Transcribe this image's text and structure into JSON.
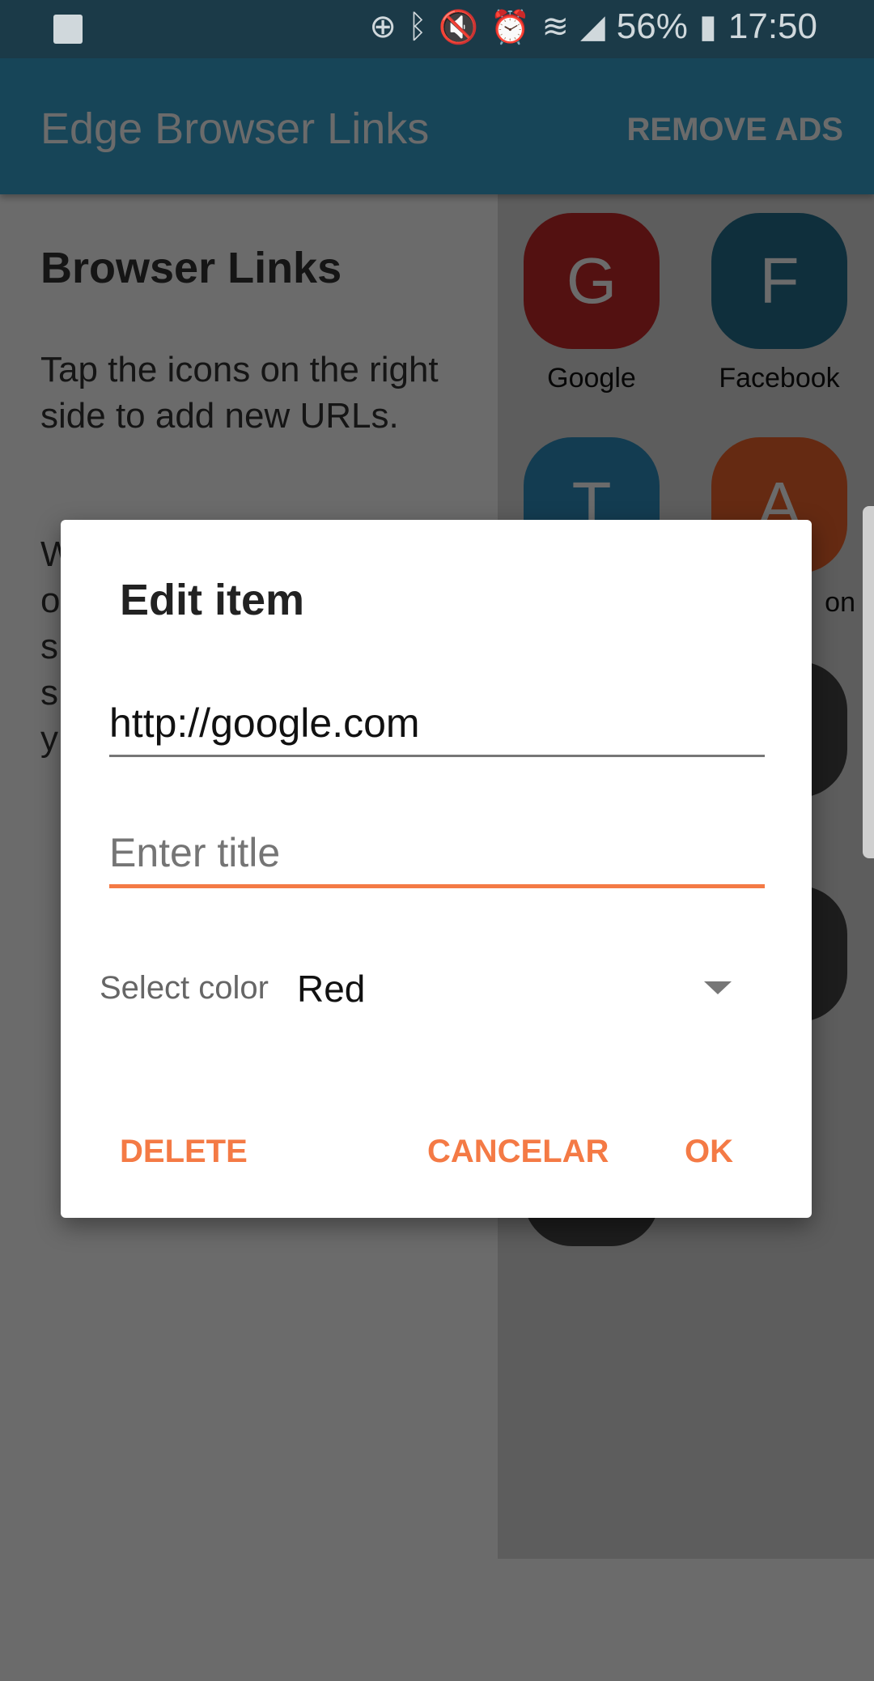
{
  "status_bar": {
    "battery": "56%",
    "time": "17:50",
    "icons": [
      "image-icon",
      "data-saver-icon",
      "bluetooth-icon",
      "mute-vibrate-icon",
      "alarm-icon",
      "wifi-icon",
      "signal-icon",
      "battery-charging-icon"
    ]
  },
  "app_bar": {
    "title": "Edge Browser Links",
    "remove_ads": "REMOVE ADS"
  },
  "left_panel": {
    "heading": "Browser Links",
    "paragraph1": "Tap the icons on the right side to add new URLs.",
    "paragraph2_visible": [
      "W",
      "o",
      "s",
      "s",
      "y"
    ]
  },
  "tiles": [
    {
      "letter": "G",
      "label": "Google",
      "color": "#c62828"
    },
    {
      "letter": "F",
      "label": "Facebook",
      "color": "#24708f"
    },
    {
      "letter": "T",
      "label": "",
      "color": "#2e8fc0"
    },
    {
      "letter": "A",
      "label": "on",
      "color": "#f0642a"
    },
    {
      "letter": "",
      "label": "",
      "color": "#f2a62a"
    },
    {
      "letter": "",
      "label": "",
      "color": "#444444"
    },
    {
      "letter": "",
      "label": "",
      "color": "#444444"
    },
    {
      "letter": "",
      "label": "",
      "color": "#444444"
    },
    {
      "letter": "",
      "label": "",
      "color": "#444444"
    }
  ],
  "dialog": {
    "title": "Edit item",
    "url_value": "http://google.com",
    "title_placeholder": "Enter title",
    "select_label": "Select color",
    "select_value": "Red",
    "delete": "DELETE",
    "cancel": "CANCELAR",
    "ok": "OK",
    "accent": "#f47a45"
  }
}
